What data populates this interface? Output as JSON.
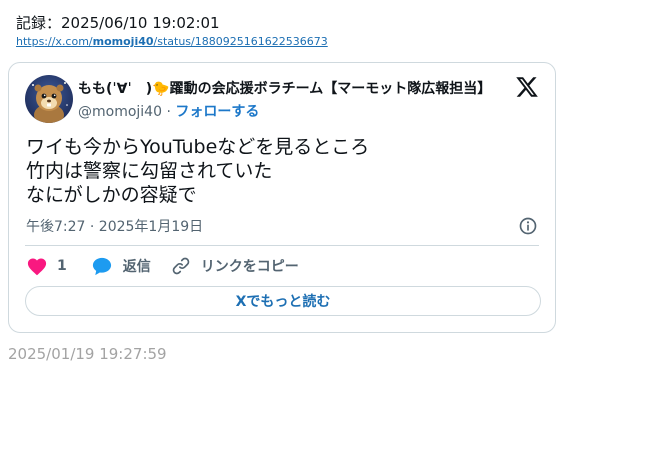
{
  "record": {
    "label": "記録：2025/06/10 19:02:01",
    "link_prefix": "https://x.com/",
    "link_user": "momoji40",
    "link_suffix": "/status/1880925161622536673"
  },
  "tweet": {
    "display_name": "もも(ˈ∀ˈ　)🐤躍動の会応援ボラチーム【マーモット隊広報担当】",
    "handle": "@momoji40",
    "separator": " · ",
    "follow_label": "フォローする",
    "text_lines": [
      "ワイも今からYouTubeなどを見るところ",
      "竹内は警察に勾留されていた",
      "なにがしかの容疑で"
    ],
    "timestamp": "午後7:27 · 2025年1月19日",
    "like_count": "1",
    "reply_label": "返信",
    "copy_link_label": "リンクをコピー",
    "read_more_label": "Xでもっと読む"
  },
  "footer": {
    "post_date": "2025/01/19 19:27:59"
  },
  "icons": {
    "like": "heart-icon",
    "reply": "speech-bubble-icon",
    "copy": "link-icon",
    "info": "info-icon",
    "brand": "x-logo-icon",
    "avatar": "marmot-avatar"
  },
  "colors": {
    "like": "#f91880",
    "reply": "#1d9bf0",
    "link": "#1d6fb3",
    "muted": "#536471",
    "border": "#cfd9de"
  }
}
